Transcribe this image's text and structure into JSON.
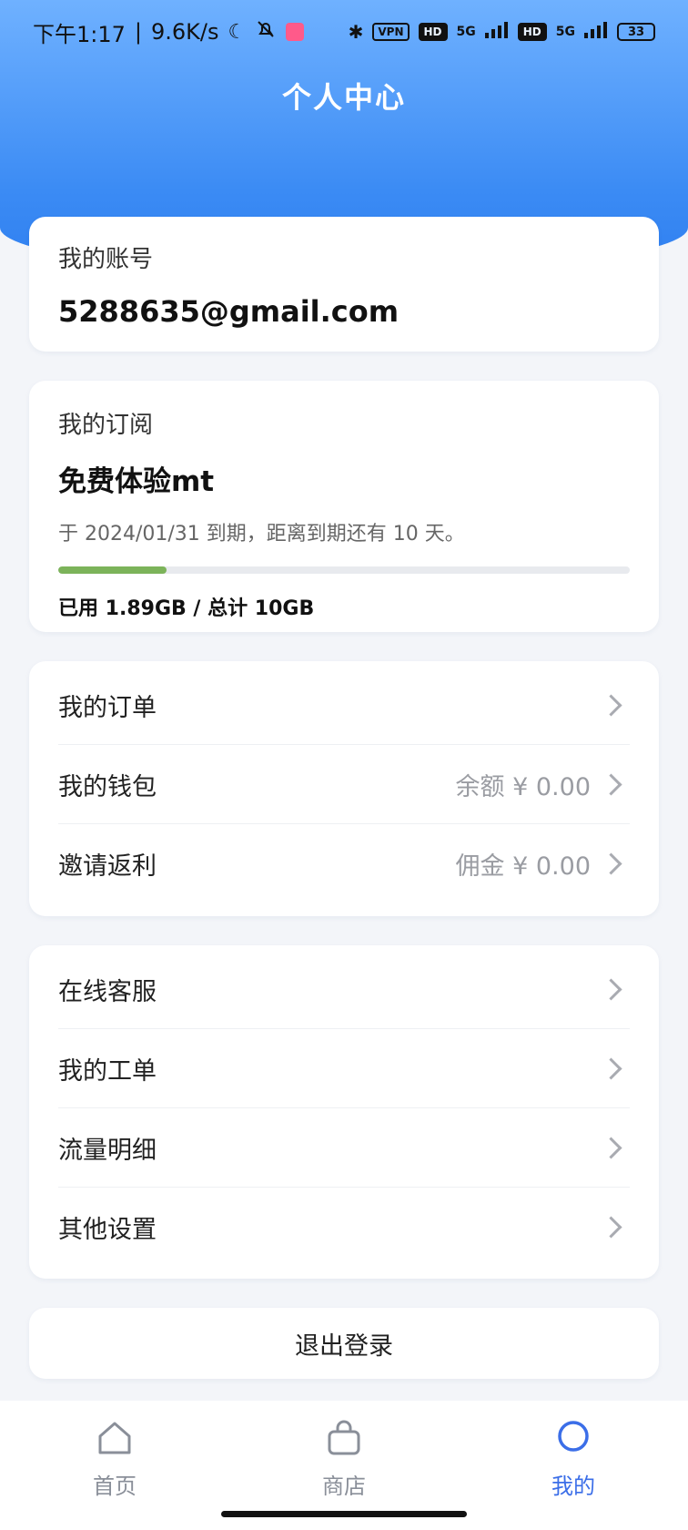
{
  "status": {
    "time": "下午1:17",
    "speed": "9.6K/s",
    "vpn": "VPN",
    "hd": "HD",
    "net": "5G",
    "battery": "33"
  },
  "header": {
    "title": "个人中心"
  },
  "account": {
    "label": "我的账号",
    "email": "5288635@gmail.com"
  },
  "subscription": {
    "label": "我的订阅",
    "plan": "免费体验mt",
    "expiry_text": "于 2024/01/31 到期，距离到期还有 10 天。",
    "usage_text": "已用 1.89GB / 总计 10GB",
    "usage_fraction": 0.189
  },
  "menu1": {
    "orders": {
      "label": "我的订单"
    },
    "wallet": {
      "label": "我的钱包",
      "value": "余额 ¥ 0.00"
    },
    "invite": {
      "label": "邀请返利",
      "value": "佣金 ¥ 0.00"
    }
  },
  "menu2": {
    "service": {
      "label": "在线客服"
    },
    "tickets": {
      "label": "我的工单"
    },
    "traffic": {
      "label": "流量明细"
    },
    "settings": {
      "label": "其他设置"
    }
  },
  "logout": {
    "label": "退出登录"
  },
  "tabs": [
    {
      "label": "首页",
      "icon": "home-icon"
    },
    {
      "label": "商店",
      "icon": "shopping-bag-icon"
    },
    {
      "label": "我的",
      "icon": "profile-circle-icon"
    }
  ],
  "colors": {
    "accent": "#3b6ee8",
    "header": "#3b8bf4",
    "progress": "#7cb35a"
  }
}
